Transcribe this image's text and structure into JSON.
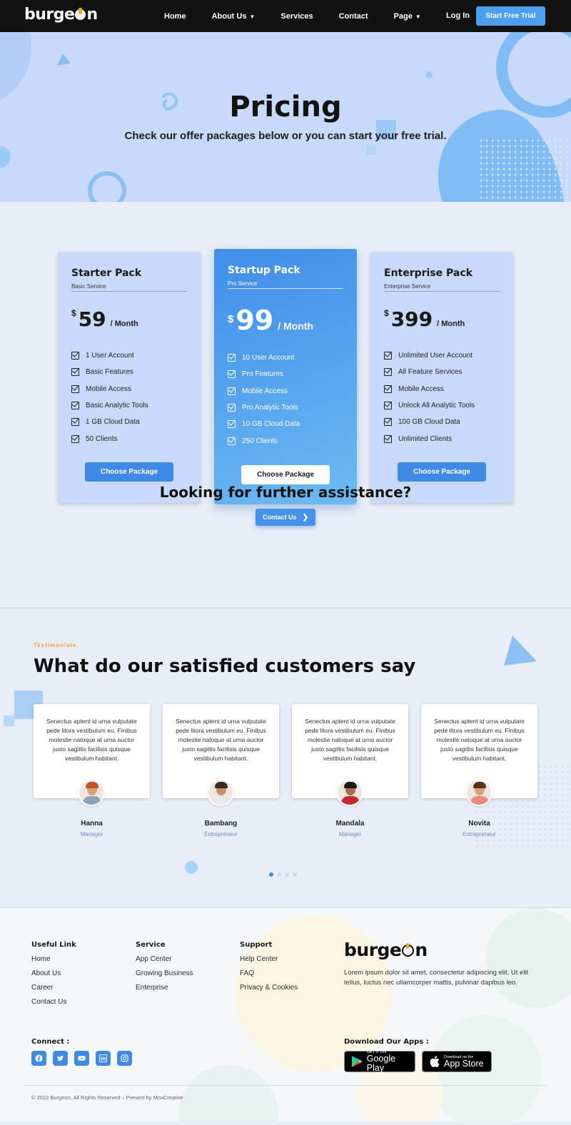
{
  "nav": {
    "logo_prefix": "burge",
    "logo_suffix": "n",
    "links": [
      "Home",
      "About Us",
      "Services",
      "Contact",
      "Page"
    ],
    "login": "Log In",
    "cta": "Start Free Trial"
  },
  "hero": {
    "title": "Pricing",
    "subtitle": "Check our offer packages below or you can start your free trial."
  },
  "plans": [
    {
      "name": "Starter Pack",
      "sub": "Basic Service",
      "currency": "$",
      "amount": "59",
      "period": "/ Month",
      "features": [
        "1 User Account",
        "Basic Features",
        "Mobile Access",
        "Basic Analytic Tools",
        "1 GB Cloud Data",
        "50 Clients"
      ],
      "button": "Choose Package"
    },
    {
      "name": "Startup Pack",
      "sub": "Pro Service",
      "currency": "$",
      "amount": "99",
      "period": "/ Month",
      "features": [
        "10 User Account",
        "Pro Features",
        "Mobile Access",
        "Pro Analytic Tools",
        "10 GB Cloud Data",
        "250 Clients"
      ],
      "button": "Choose Package"
    },
    {
      "name": "Enterprise Pack",
      "sub": "Enterprise Service",
      "currency": "$",
      "amount": "399",
      "period": "/ Month",
      "features": [
        "Unlimited User Account",
        "All Feature Services",
        "Mobile Access",
        "Unlock All Analytic Tools",
        "100 GB Cloud Data",
        "Unlimited Clients"
      ],
      "button": "Choose Package"
    }
  ],
  "assist": {
    "title": "Looking for further assistance?",
    "button": "Contact Us"
  },
  "testimonials": {
    "kicker": "Testimonials",
    "title": "What do our satisfied customers say",
    "items": [
      {
        "quote": "Senectus aptent id urna vulputate pede litora vestibulum eu. Finibus molestie natoque at urna auctor justo sagittis facilisis quisque vestibulum habitant.",
        "name": "Hanna",
        "role": "Manager"
      },
      {
        "quote": "Senectus aptent id urna vulputate pede litora vestibulum eu. Finibus molestie natoque at urna auctor justo sagittis facilisis quisque vestibulum habitant.",
        "name": "Bambang",
        "role": "Entrepreneur"
      },
      {
        "quote": "Senectus aptent id urna vulputate pede litora vestibulum eu. Finibus molestie natoque at urna auctor justo sagittis facilisis quisque vestibulum habitant.",
        "name": "Mandala",
        "role": "Manager"
      },
      {
        "quote": "Senectus aptent id urna vulputate pede litora vestibulum eu. Finibus molestie natoque at urna auctor justo sagittis facilisis quisque vestibulum habitant.",
        "name": "Novita",
        "role": "Entrepreneur"
      }
    ]
  },
  "footer": {
    "useful": {
      "title": "Useful Link",
      "links": [
        "Home",
        "About Us",
        "Career",
        "Contact Us"
      ]
    },
    "service": {
      "title": "Service",
      "links": [
        "App Center",
        "Growing Business",
        "Enterprise"
      ]
    },
    "support": {
      "title": "Support",
      "links": [
        "Help Center",
        "FAQ",
        "Privacy & Cookies"
      ]
    },
    "logo_prefix": "burge",
    "logo_suffix": "n",
    "description": "Lorem ipsum dolor sit amet, consectetur adipiscing elit. Ut elit tellus, luctus nec ullamcorper mattis, pulvinar dapibus leo.",
    "connect": "Connect :",
    "socials": [
      "facebook-icon",
      "twitter-icon",
      "youtube-icon",
      "linkedin-icon",
      "instagram-icon"
    ],
    "download": "Download Our Apps :",
    "google_small": "GET IT ON",
    "google_big": "Google Play",
    "apple_small": "Download on the",
    "apple_big": "App Store",
    "copyright": "© 2022 Burgeon, All Rights Reserved – Present by MoxCreative"
  },
  "colors": {
    "accent": "#3e8ae6",
    "hero_bg": "#c8d9fb",
    "kicker": "#f5a030",
    "nav_bg": "#121212"
  }
}
